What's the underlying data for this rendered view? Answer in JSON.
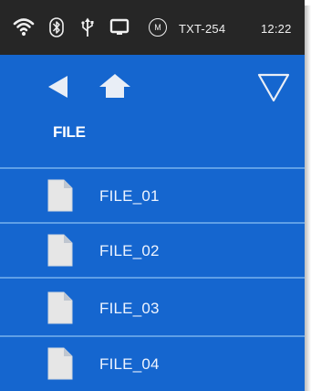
{
  "statusbar": {
    "icons": [
      "wifi-icon",
      "bluetooth-icon",
      "usb-icon",
      "display-icon",
      "m-badge-icon"
    ],
    "m_badge": "M",
    "device_name": "TXT-254",
    "time": "12:22"
  },
  "nav": {
    "back_icon": "back-arrow-icon",
    "home_icon": "home-icon",
    "menu_icon": "dropdown-triangle-icon"
  },
  "folder": {
    "title": "FILE"
  },
  "files": [
    {
      "name": "FILE_01",
      "icon": "document-icon"
    },
    {
      "name": "FILE_02",
      "icon": "document-icon"
    },
    {
      "name": "FILE_03",
      "icon": "document-icon"
    },
    {
      "name": "FILE_04",
      "icon": "document-icon"
    }
  ],
  "colors": {
    "statusbar_bg": "#262626",
    "main_bg": "#1566cf",
    "divider": "#5f9fe6",
    "text": "#ffffff"
  }
}
